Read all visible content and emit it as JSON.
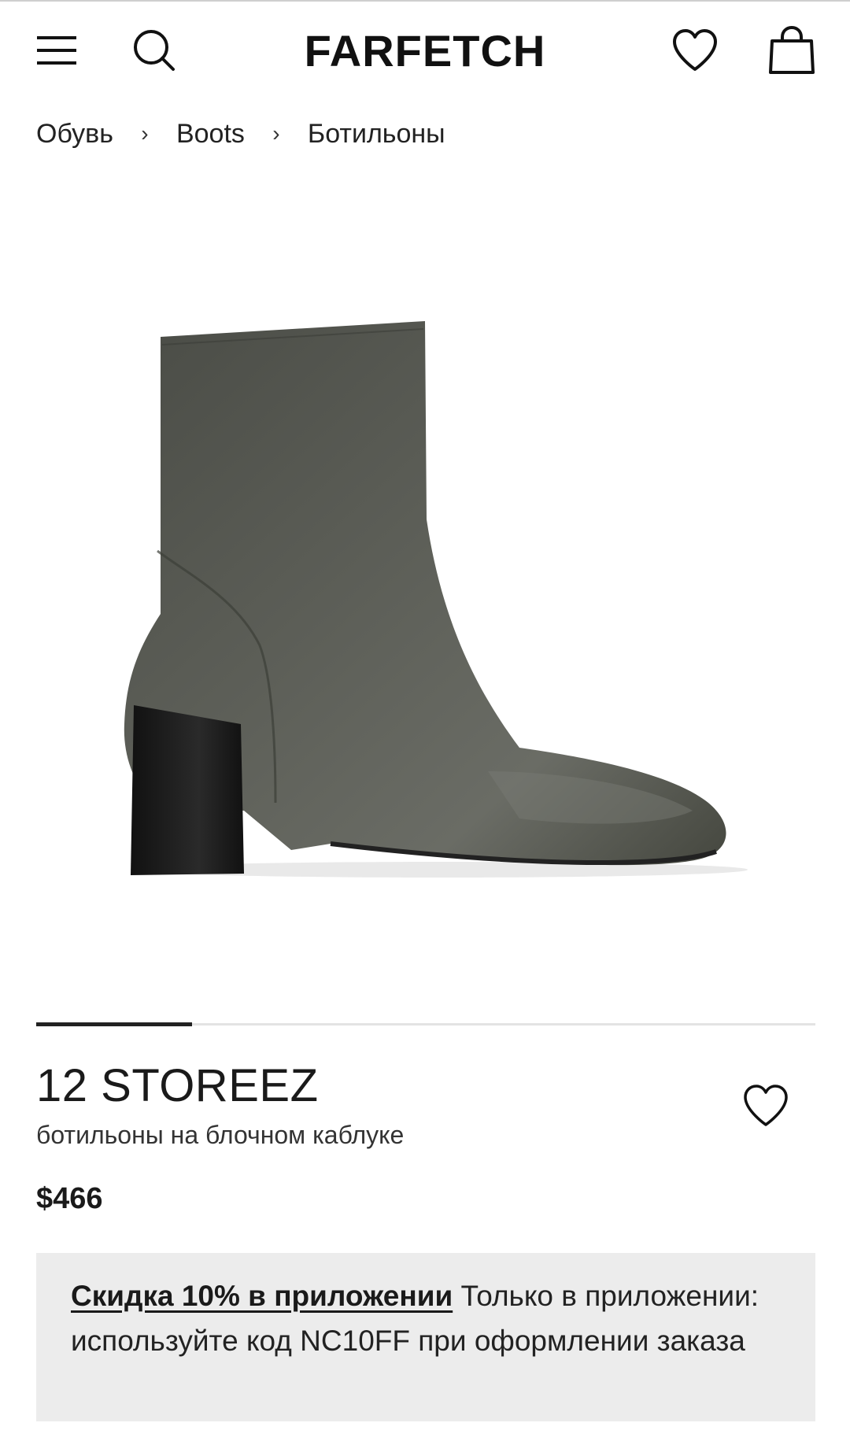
{
  "header": {
    "logo": "FARFETCH",
    "icons": [
      "menu-icon",
      "search-icon",
      "heart-icon",
      "bag-icon"
    ]
  },
  "breadcrumb": {
    "items": [
      "Обувь",
      "Boots",
      "Ботильоны"
    ],
    "separator": "›"
  },
  "product": {
    "image_alt_icon": "ankle-boot-image",
    "carousel_progress": 0.2,
    "brand": "12 STOREEZ",
    "name": "ботильоны на блочном каблуке",
    "price": "$466"
  },
  "promo": {
    "link_text": "Скидка 10% в приложении",
    "text": " Только в приложении: используйте код NC10FF при оформлении заказа"
  },
  "colors": {
    "boot": "#54564f",
    "heel": "#1c1c1c",
    "promo_bg": "#ececec",
    "text": "#222222"
  }
}
